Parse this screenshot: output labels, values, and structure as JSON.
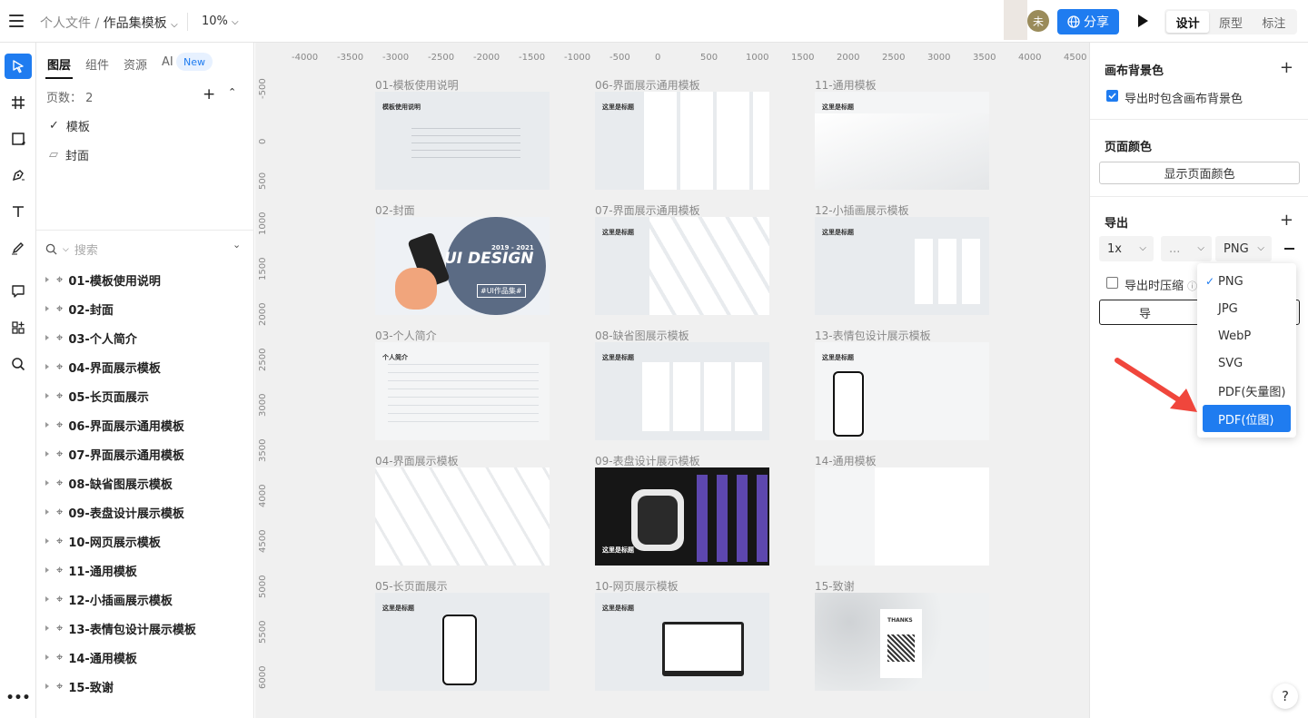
{
  "topbar": {
    "breadcrumb_parent": "个人文件 /",
    "file_name": "作品集模板",
    "zoom": "10%",
    "avatar_text": "未",
    "share_label": "分享",
    "modes": [
      "设计",
      "原型",
      "标注"
    ],
    "active_mode": "设计"
  },
  "layers_panel": {
    "tabs": [
      "图层",
      "组件",
      "资源",
      "AI"
    ],
    "new_badge": "New",
    "page_count_label": "页数：",
    "page_count": "2",
    "pages": [
      "模板",
      "封面"
    ],
    "search_placeholder": "搜索",
    "layers": [
      "01-模板使用说明",
      "02-封面",
      "03-个人简介",
      "04-界面展示模板",
      "05-长页面展示",
      "06-界面展示通用模板",
      "07-界面展示通用模板",
      "08-缺省图展示模板",
      "09-表盘设计展示模板",
      "10-网页展示模板",
      "11-通用模板",
      "12-小插画展示模板",
      "13-表情包设计展示模板",
      "14-通用模板",
      "15-致谢"
    ]
  },
  "canvas": {
    "ruler_h": [
      "-4000",
      "-3500",
      "-3000",
      "-2500",
      "-2000",
      "-1500",
      "-1000",
      "-500",
      "0",
      "500",
      "1000",
      "1500",
      "2000",
      "2500",
      "3000",
      "3500",
      "4000",
      "4500"
    ],
    "ruler_v": [
      "-500",
      "0",
      "500",
      "1000",
      "1500",
      "2000",
      "2500",
      "3000",
      "3500",
      "4000",
      "4500",
      "5000",
      "5500",
      "6000"
    ],
    "boards": [
      {
        "label": "01-模板使用说明",
        "title": "模板使用说明",
        "style": "light"
      },
      {
        "label": "06-界面展示通用模板",
        "title": "这里是标题",
        "style": "light"
      },
      {
        "label": "11-通用模板",
        "title": "这里是标题",
        "style": "white"
      },
      {
        "label": "02-封面",
        "title": "UI DESIGN",
        "style": "cover"
      },
      {
        "label": "07-界面展示通用模板",
        "title": "这里是标题",
        "style": "light"
      },
      {
        "label": "12-小插画展示模板",
        "title": "这里是标题",
        "style": "light"
      },
      {
        "label": "03-个人简介",
        "title": "个人简介",
        "style": "white"
      },
      {
        "label": "08-缺省图展示模板",
        "title": "这里是标题",
        "style": "light"
      },
      {
        "label": "13-表情包设计展示模板",
        "title": "这里是标题",
        "style": "white"
      },
      {
        "label": "04-界面展示模板",
        "title": "",
        "style": "white"
      },
      {
        "label": "09-表盘设计展示模板",
        "title": "这里是标题",
        "style": "dark"
      },
      {
        "label": "14-通用模板",
        "title": "",
        "style": "white"
      },
      {
        "label": "05-长页面展示",
        "title": "这里是标题",
        "style": "light"
      },
      {
        "label": "10-网页展示模板",
        "title": "这里是标题",
        "style": "light"
      },
      {
        "label": "15-致谢",
        "title": "THANKS",
        "style": "light"
      }
    ],
    "cover_year": "2019 - 2021",
    "cover_sub": "#UI作品集#"
  },
  "right_panel": {
    "canvas_bg_title": "画布背景色",
    "include_bg_label": "导出时包含画布背景色",
    "page_color_title": "页面颜色",
    "show_page_color_label": "显示页面颜色",
    "export_title": "导出",
    "scale": "1x",
    "suffix": "...",
    "format": "PNG",
    "compress_label": "导出时压缩",
    "export_button": "导"
  },
  "format_dropdown": {
    "options": [
      "PNG",
      "JPG",
      "WebP",
      "SVG",
      "PDF(矢量图)",
      "PDF(位图)"
    ],
    "selected": "PNG",
    "highlighted": "PDF(位图)"
  },
  "help_label": "?",
  "colors": {
    "accent": "#1f7cf0",
    "arrow": "#f0463c",
    "canvas_bg": "#f0f0f0"
  }
}
